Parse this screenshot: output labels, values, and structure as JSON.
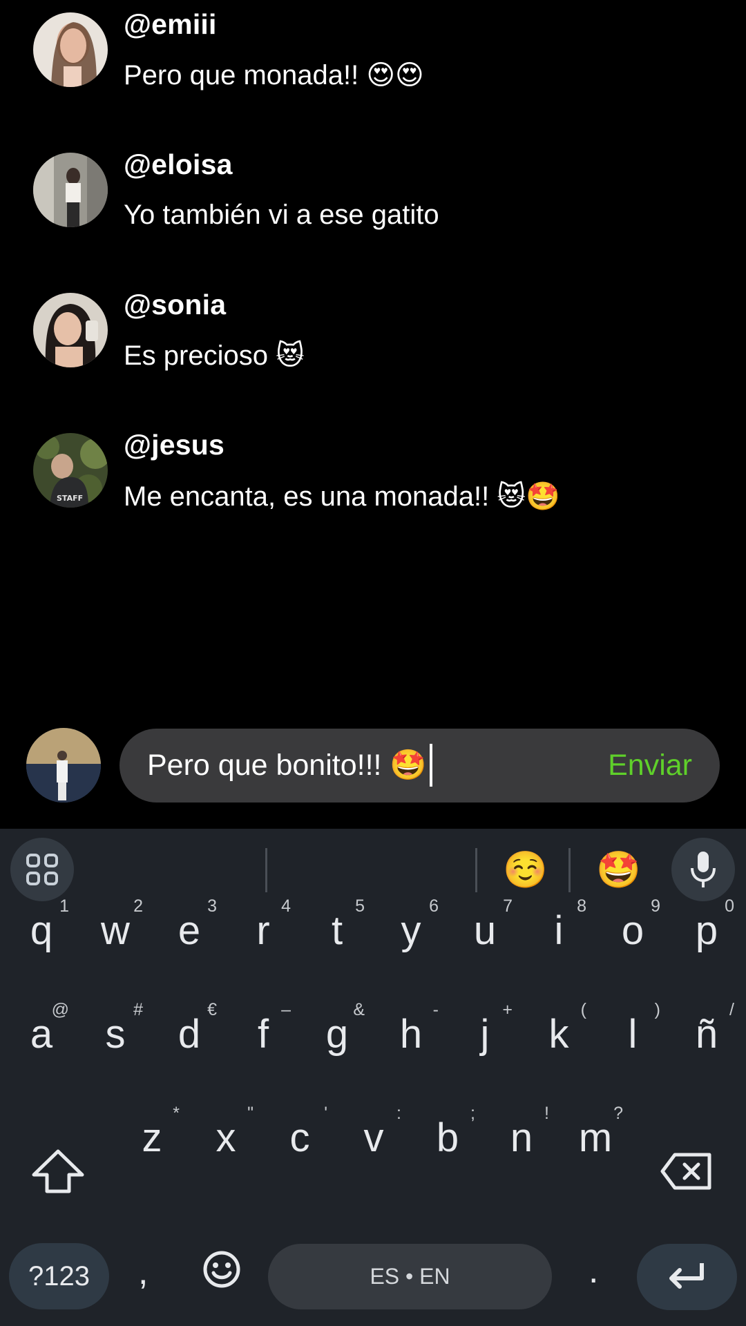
{
  "comments": [
    {
      "username": "@emiii",
      "text": "Pero que monada!!",
      "emoji": "😍😍"
    },
    {
      "username": "@eloisa",
      "text": "Yo también vi a ese gatito",
      "emoji": ""
    },
    {
      "username": "@sonia",
      "text": "Es precioso",
      "emoji": "😻"
    },
    {
      "username": "@jesus",
      "text": "Me encanta, es una monada!!",
      "emoji": "😻🤩"
    }
  ],
  "composer": {
    "value": "Pero que bonito!!!",
    "value_emoji": "🤩",
    "send_label": "Enviar",
    "send_color": "#5fd02a"
  },
  "keyboard": {
    "suggestions": [
      "☺️",
      "🤩"
    ],
    "row1": [
      {
        "k": "q",
        "s": "1"
      },
      {
        "k": "w",
        "s": "2"
      },
      {
        "k": "e",
        "s": "3"
      },
      {
        "k": "r",
        "s": "4"
      },
      {
        "k": "t",
        "s": "5"
      },
      {
        "k": "y",
        "s": "6"
      },
      {
        "k": "u",
        "s": "7"
      },
      {
        "k": "i",
        "s": "8"
      },
      {
        "k": "o",
        "s": "9"
      },
      {
        "k": "p",
        "s": "0"
      }
    ],
    "row2": [
      {
        "k": "a",
        "s": "@"
      },
      {
        "k": "s",
        "s": "#"
      },
      {
        "k": "d",
        "s": "€"
      },
      {
        "k": "f",
        "s": "–"
      },
      {
        "k": "g",
        "s": "&"
      },
      {
        "k": "h",
        "s": "-"
      },
      {
        "k": "j",
        "s": "+"
      },
      {
        "k": "k",
        "s": "("
      },
      {
        "k": "l",
        "s": ")"
      },
      {
        "k": "ñ",
        "s": "/"
      }
    ],
    "row3": [
      {
        "k": "z",
        "s": "*"
      },
      {
        "k": "x",
        "s": "\""
      },
      {
        "k": "c",
        "s": "'"
      },
      {
        "k": "v",
        "s": ":"
      },
      {
        "k": "b",
        "s": ";"
      },
      {
        "k": "n",
        "s": "!"
      },
      {
        "k": "m",
        "s": "?"
      }
    ],
    "symbols_label": "?123",
    "comma": ",",
    "space_label": "ES • EN",
    "period": "."
  },
  "icons": {
    "toolbar": "apps-grid-icon",
    "mic": "microphone-icon",
    "shift": "shift-icon",
    "backspace": "backspace-icon",
    "emoji": "emoji-smile-icon",
    "enter": "enter-icon"
  }
}
